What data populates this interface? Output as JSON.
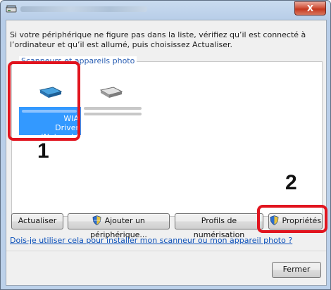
{
  "window": {
    "close_label": "X"
  },
  "instructions": "Si votre périphérique ne figure pas dans la liste, vérifiez qu’il est connecté à l’ordinateur et qu’il est allumé, puis choisissez Actualiser.",
  "group": {
    "label": "Scanneurs et appareils photo",
    "devices": [
      {
        "icon": "scanner-icon",
        "label_lines": [
          "WIA",
          "Driver (Network)"
        ],
        "selected": true
      },
      {
        "icon": "scanner-icon",
        "label_lines": [],
        "selected": false
      }
    ]
  },
  "annotations": {
    "first": "1",
    "second": "2",
    "highlight_color": "#e1141e"
  },
  "buttons": {
    "refresh": "Actualiser",
    "add_device": "Ajouter un périphérique...",
    "scan_profiles": "Profils de numérisation",
    "properties": "Propriétés",
    "close": "Fermer"
  },
  "help_link": "Dois-je utiliser cela pour installer mon scanneur ou mon appareil photo ?",
  "colors": {
    "selection": "#3399ff",
    "link": "#0a4fb9"
  }
}
